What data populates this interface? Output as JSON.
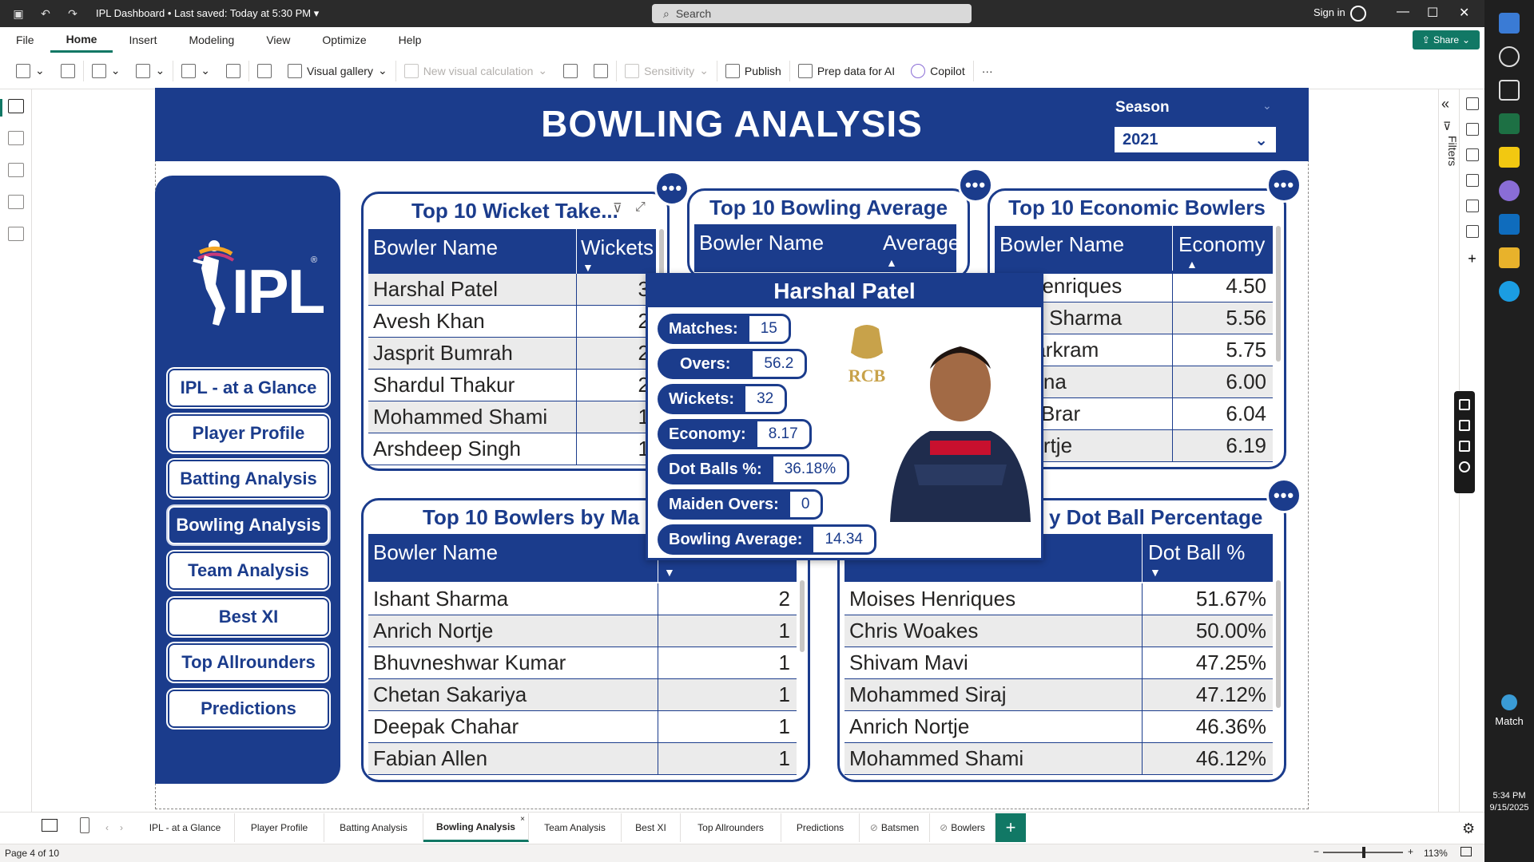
{
  "titlebar": {
    "doc_title": "IPL Dashboard",
    "saved": "• Last saved: Today at 5:30 PM",
    "search_placeholder": "Search",
    "signin": "Sign in"
  },
  "menu": [
    "File",
    "Home",
    "Insert",
    "Modeling",
    "View",
    "Optimize",
    "Help"
  ],
  "menu_active": "Home",
  "share_label": "Share",
  "ribbon": {
    "visual_gallery": "Visual gallery",
    "new_visual_calc": "New visual calculation",
    "sensitivity": "Sensitivity",
    "publish": "Publish",
    "prep_data": "Prep data for AI",
    "copilot": "Copilot",
    "more": "···"
  },
  "filters_label": "Filters",
  "report": {
    "title": "BOWLING ANALYSIS",
    "season_label": "Season",
    "season_value": "2021",
    "logo_text": "IPL",
    "logo_reg": "®"
  },
  "nav_buttons": [
    {
      "label": "IPL - at a Glance",
      "active": false
    },
    {
      "label": "Player Profile",
      "active": false
    },
    {
      "label": "Batting Analysis",
      "active": false
    },
    {
      "label": "Bowling Analysis",
      "active": true
    },
    {
      "label": "Team Analysis",
      "active": false
    },
    {
      "label": "Best XI",
      "active": false
    },
    {
      "label": "Top Allrounders",
      "active": false
    },
    {
      "label": "Predictions",
      "active": false
    }
  ],
  "wickets_card": {
    "title": "Top 10 Wicket Take...",
    "col1": "Bowler Name",
    "col2": "Wickets",
    "rows": [
      {
        "name": "Harshal Patel",
        "value": "3"
      },
      {
        "name": "Avesh Khan",
        "value": "2"
      },
      {
        "name": "Jasprit Bumrah",
        "value": "2"
      },
      {
        "name": "Shardul Thakur",
        "value": "2"
      },
      {
        "name": "Mohammed Shami",
        "value": "1"
      },
      {
        "name": "Arshdeep Singh",
        "value": "1"
      }
    ]
  },
  "average_card": {
    "title": "Top 10 Bowling Average",
    "col1": "Bowler Name",
    "col2": "Average"
  },
  "economy_card": {
    "title": "Top 10 Economic Bowlers",
    "col1": "Bowler Name",
    "col2": "Economy",
    "rows": [
      {
        "name": "es Henriques",
        "value": "4.50"
      },
      {
        "name": "shek Sharma",
        "value": "5.56"
      },
      {
        "name": "n Markram",
        "value": "5.75"
      },
      {
        "name": "h Rana",
        "value": "6.00"
      },
      {
        "name": "reet Brar",
        "value": "6.04"
      },
      {
        "name": "h Nortje",
        "value": "6.19"
      }
    ]
  },
  "maidens_card": {
    "title": "Top 10 Bowlers by Ma",
    "col1": "Bowler Name",
    "rows": [
      {
        "name": "Ishant Sharma",
        "value": "2"
      },
      {
        "name": "Anrich Nortje",
        "value": "1"
      },
      {
        "name": "Bhuvneshwar Kumar",
        "value": "1"
      },
      {
        "name": "Chetan Sakariya",
        "value": "1"
      },
      {
        "name": "Deepak Chahar",
        "value": "1"
      },
      {
        "name": "Fabian Allen",
        "value": "1"
      }
    ]
  },
  "dotball_card": {
    "title": "y Dot Ball Percentage",
    "col2": "Dot Ball %",
    "rows": [
      {
        "name": "Moises Henriques",
        "value": "51.67%"
      },
      {
        "name": "Chris Woakes",
        "value": "50.00%"
      },
      {
        "name": "Shivam Mavi",
        "value": "47.25%"
      },
      {
        "name": "Mohammed Siraj",
        "value": "47.12%"
      },
      {
        "name": "Anrich Nortje",
        "value": "46.36%"
      },
      {
        "name": "Mohammed Shami",
        "value": "46.12%"
      }
    ]
  },
  "tooltip": {
    "player": "Harshal Patel",
    "team_logo_text": "RCB",
    "stats": [
      {
        "label": "Matches:",
        "value": "15"
      },
      {
        "label": "Overs:",
        "value": "56.2"
      },
      {
        "label": "Wickets:",
        "value": "32"
      },
      {
        "label": "Economy:",
        "value": "8.17"
      },
      {
        "label": "Dot Balls %:",
        "value": "36.18%"
      },
      {
        "label": "Maiden Overs:",
        "value": "0"
      },
      {
        "label": "Bowling Average:",
        "value": "14.34"
      }
    ]
  },
  "page_tabs": [
    {
      "label": "IPL - at a Glance",
      "active": false,
      "hidden": false
    },
    {
      "label": "Player Profile",
      "active": false,
      "hidden": false
    },
    {
      "label": "Batting Analysis",
      "active": false,
      "hidden": false
    },
    {
      "label": "Bowling Analysis",
      "active": true,
      "hidden": false
    },
    {
      "label": "Team Analysis",
      "active": false,
      "hidden": false
    },
    {
      "label": "Best XI",
      "active": false,
      "hidden": false
    },
    {
      "label": "Top Allrounders",
      "active": false,
      "hidden": false
    },
    {
      "label": "Predictions",
      "active": false,
      "hidden": false
    },
    {
      "label": "Batsmen",
      "active": false,
      "hidden": true
    },
    {
      "label": "Bowlers",
      "active": false,
      "hidden": true
    }
  ],
  "status": {
    "page": "Page 4 of 10",
    "zoom": "113%"
  },
  "taskbar": {
    "match_label": "Match",
    "time": "5:34 PM",
    "date": "9/15/2025"
  },
  "colors": {
    "brand_blue": "#1b3c8c",
    "accent_green": "#117865"
  }
}
